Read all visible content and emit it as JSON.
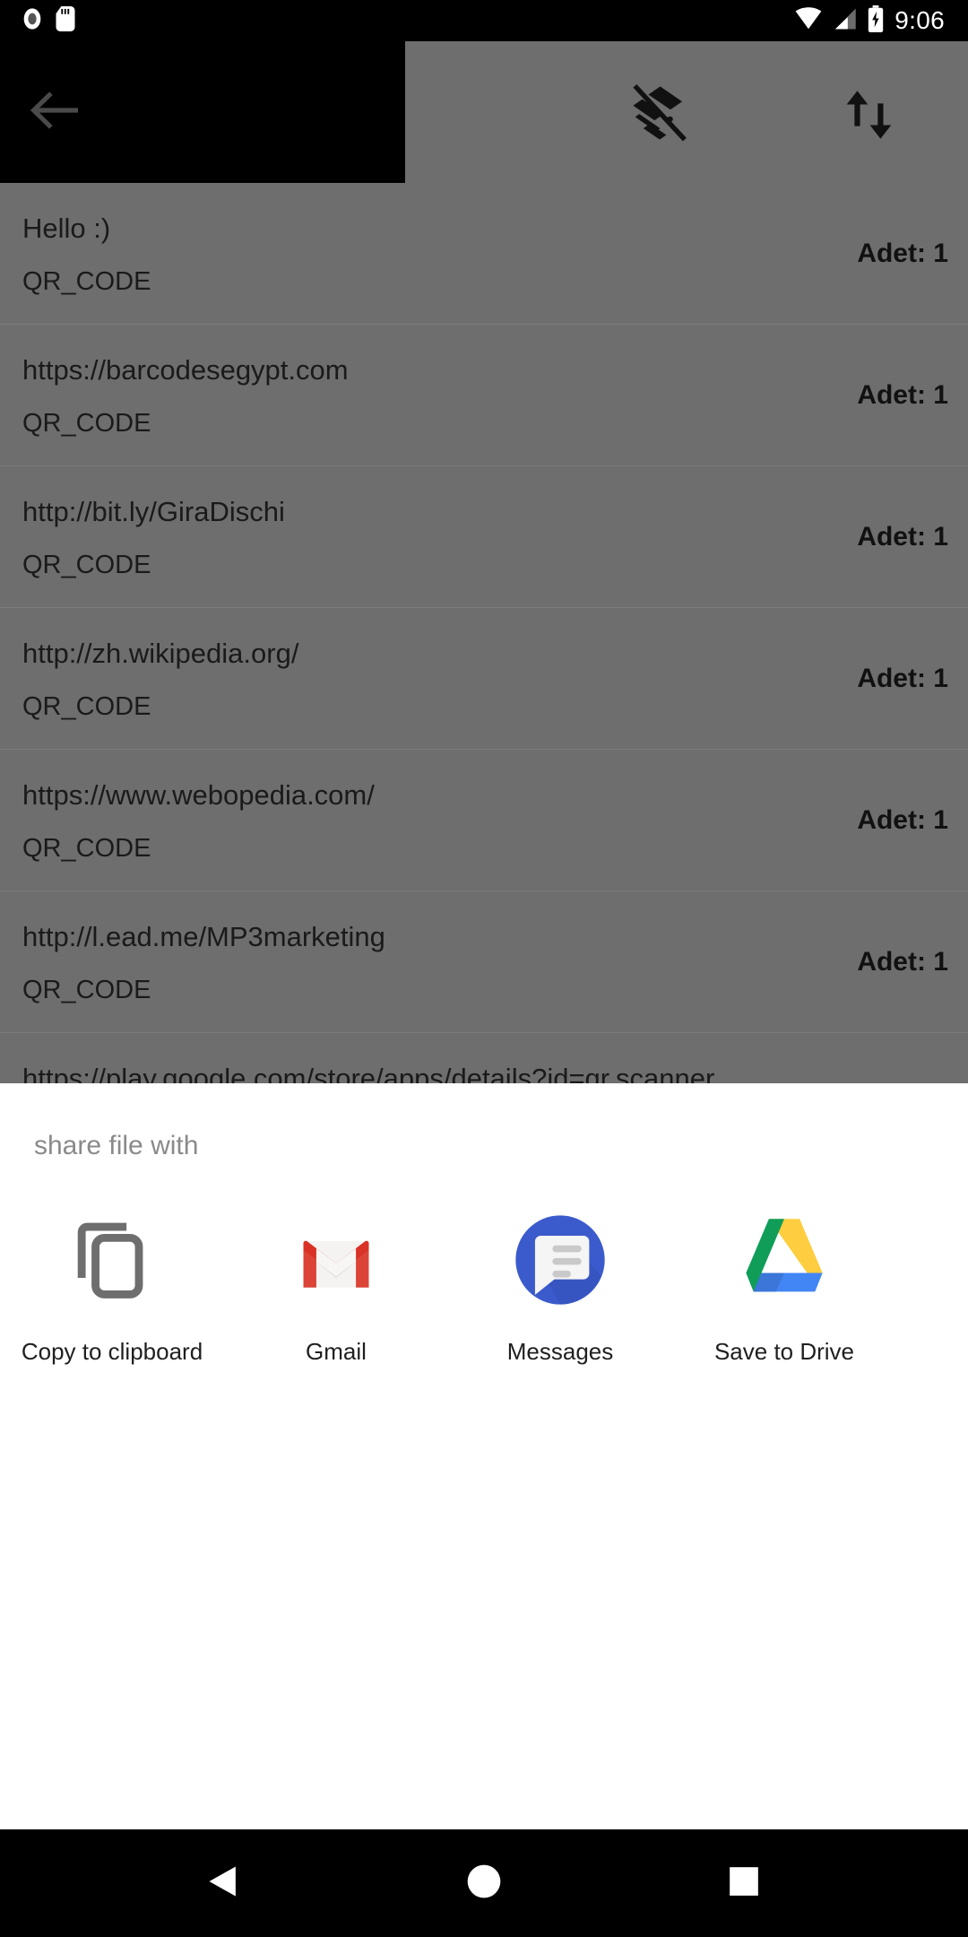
{
  "status_bar": {
    "time": "9:06",
    "icons": [
      "record-icon",
      "sd-card-icon",
      "wifi-icon",
      "cellular-signal-icon",
      "battery-charging-icon"
    ]
  },
  "toolbar": {
    "back_icon": "back-arrow-icon",
    "action_1_icon": "layers-off-icon",
    "action_2_icon": "sort-arrows-icon"
  },
  "list": {
    "rows": [
      {
        "title": "Hello :)",
        "subtitle": "QR_CODE",
        "count": "Adet: 1"
      },
      {
        "title": "https://barcodesegypt.com",
        "subtitle": "QR_CODE",
        "count": "Adet: 1"
      },
      {
        "title": "http://bit.ly/GiraDischi",
        "subtitle": "QR_CODE",
        "count": "Adet: 1"
      },
      {
        "title": "http://zh.wikipedia.org/",
        "subtitle": "QR_CODE",
        "count": "Adet: 1"
      },
      {
        "title": "https://www.webopedia.com/",
        "subtitle": "QR_CODE",
        "count": "Adet: 1"
      },
      {
        "title": "http://l.ead.me/MP3marketing",
        "subtitle": "QR_CODE",
        "count": "Adet: 1"
      },
      {
        "title": "https://play.google.com/store/apps/details?id=qr.scanner",
        "subtitle": "",
        "count": ""
      }
    ]
  },
  "share_sheet": {
    "title": "share file with",
    "targets": [
      {
        "label": "Copy to clipboard",
        "icon": "copy-to-clipboard-icon"
      },
      {
        "label": "Gmail",
        "icon": "gmail-icon"
      },
      {
        "label": "Messages",
        "icon": "messages-icon"
      },
      {
        "label": "Save to Drive",
        "icon": "google-drive-icon"
      }
    ]
  },
  "nav_bar": {
    "back_icon": "nav-back-triangle-icon",
    "home_icon": "nav-home-circle-icon",
    "recents_icon": "nav-recents-square-icon"
  },
  "colors": {
    "scrim": "#6e6e6e",
    "sheet_bg": "#ffffff",
    "clipboard_gray": "#6e6e6e",
    "gmail_red": "#db4437",
    "messages_blue": "#3b5bcc",
    "drive_green": "#0f9d58",
    "drive_yellow": "#ffcd40",
    "drive_blue": "#4285f4"
  }
}
